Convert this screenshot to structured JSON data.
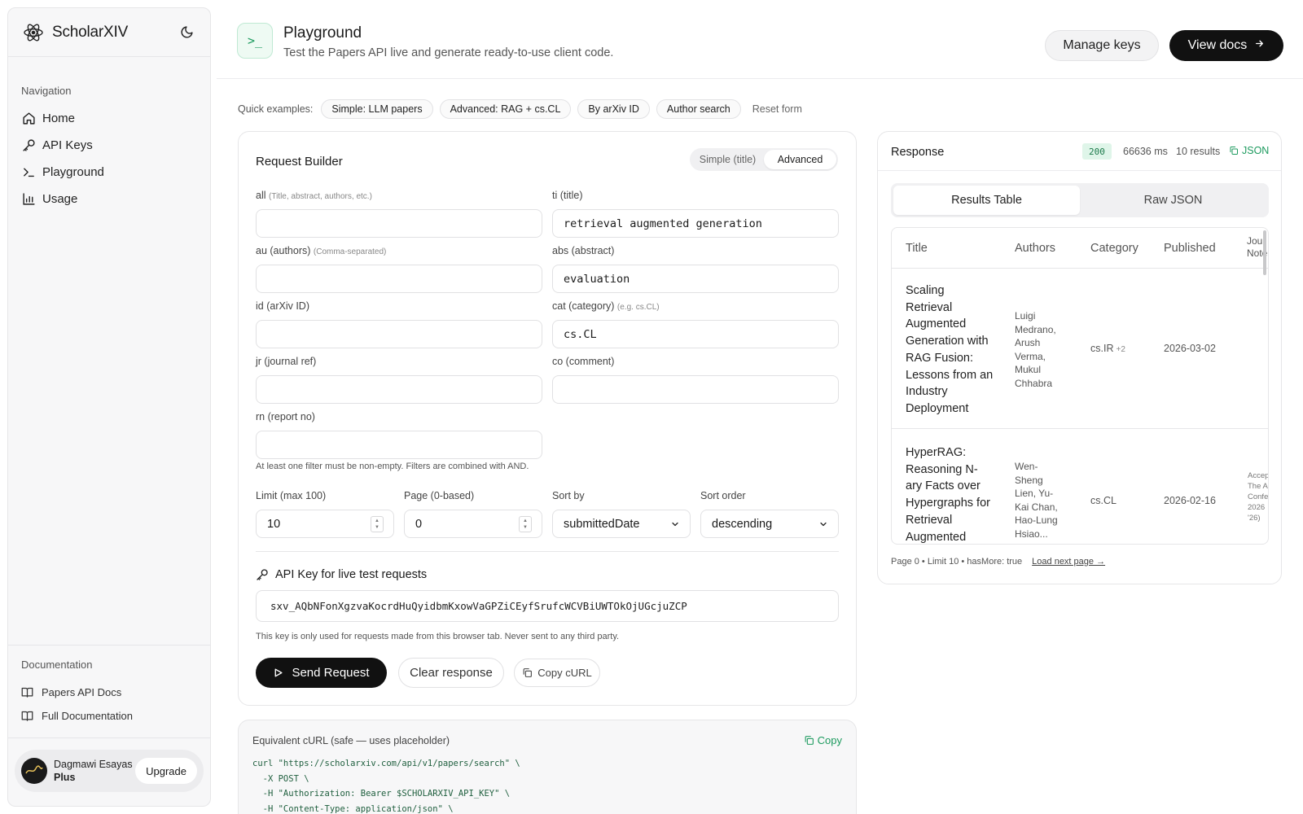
{
  "sidebar": {
    "brand": "ScholarXIV",
    "nav_title": "Navigation",
    "items": [
      {
        "label": "Home",
        "icon": "home-icon"
      },
      {
        "label": "API Keys",
        "icon": "key-icon"
      },
      {
        "label": "Playground",
        "icon": "terminal-icon"
      },
      {
        "label": "Usage",
        "icon": "bar-chart-icon"
      }
    ],
    "docs_title": "Documentation",
    "docs": [
      {
        "label": "Papers API Docs",
        "icon": "book-icon"
      },
      {
        "label": "Full Documentation",
        "icon": "book-icon"
      }
    ],
    "user": {
      "name": "Dagmawi Esayas",
      "plan": "Plus",
      "upgrade": "Upgrade"
    }
  },
  "header": {
    "title": "Playground",
    "subtitle": "Test the Papers API live and generate ready-to-use client code.",
    "manage_keys": "Manage keys",
    "view_docs": "View docs",
    "icon_glyph": ">_"
  },
  "quick": {
    "label": "Quick examples:",
    "chips": [
      "Simple: LLM papers",
      "Advanced: RAG + cs.CL",
      "By arXiv ID",
      "Author search"
    ],
    "reset": "Reset form"
  },
  "builder": {
    "title": "Request Builder",
    "mode_simple": "Simple (title)",
    "mode_advanced": "Advanced",
    "fields": {
      "all": {
        "label": "all",
        "hint": "(Title, abstract, authors, etc.)",
        "value": ""
      },
      "ti": {
        "label": "ti (title)",
        "hint": "",
        "value": "retrieval augmented generation"
      },
      "au": {
        "label": "au (authors)",
        "hint": "(Comma-separated)",
        "value": ""
      },
      "abs": {
        "label": "abs (abstract)",
        "hint": "",
        "value": "evaluation"
      },
      "id": {
        "label": "id (arXiv ID)",
        "hint": "",
        "value": ""
      },
      "cat": {
        "label": "cat (category)",
        "hint": "(e.g. cs.CL)",
        "value": "cs.CL"
      },
      "jr": {
        "label": "jr (journal ref)",
        "hint": "",
        "value": ""
      },
      "co": {
        "label": "co (comment)",
        "hint": "",
        "value": ""
      },
      "rn": {
        "label": "rn (report no)",
        "hint": "",
        "value": ""
      }
    },
    "note": "At least one filter must be non-empty. Filters are combined with AND.",
    "limit": {
      "label": "Limit (max 100)",
      "value": "10"
    },
    "page": {
      "label": "Page (0-based)",
      "value": "0"
    },
    "sort_by": {
      "label": "Sort by",
      "value": "submittedDate"
    },
    "sort_order": {
      "label": "Sort order",
      "value": "descending"
    },
    "api_key_title": "API Key for live test requests",
    "api_key_value": "sxv_AQbNFonXgzvaKocrdHuQyidbmKxowVaGPZiCEyfSrufcWCVBiUWTOkOjUGcjuZCP",
    "api_key_note": "This key is only used for requests made from this browser tab. Never sent to any third party.",
    "send": "Send Request",
    "clear": "Clear response",
    "copy_curl": "Copy cURL"
  },
  "curl": {
    "title": "Equivalent cURL (safe — uses placeholder)",
    "copy": "Copy",
    "lines": [
      "curl \"https://scholarxiv.com/api/v1/papers/search\" \\",
      "  -X POST \\",
      "  -H \"Authorization: Bearer $SCHOLARXIV_API_KEY\" \\",
      "  -H \"Content-Type: application/json\" \\"
    ]
  },
  "response": {
    "title": "Response",
    "status": "200",
    "time": "66636 ms",
    "count": "10 results",
    "json_link": "JSON",
    "tab_table": "Results Table",
    "tab_raw": "Raw JSON",
    "columns": [
      "Title",
      "Authors",
      "Category",
      "Published",
      "Jou Note"
    ],
    "rows": [
      {
        "title": "Scaling Retrieval Augmented Generation with RAG Fusion: Lessons from an Industry Deployment",
        "authors": "Luigi Medrano, Arush Verma, Mukul Chhabra",
        "category": "cs.IR",
        "category_extra": "+2",
        "published": "2026-03-02",
        "journal": ""
      },
      {
        "title": "HyperRAG: Reasoning N-ary Facts over Hypergraphs for Retrieval Augmented",
        "authors": "Wen-Sheng Lien, Yu-Kai Chan, Hao-Lung Hsiao...",
        "category": "cs.CL",
        "category_extra": "",
        "published": "2026-02-16",
        "journal": "Accep The A Confe 2026 '26)"
      }
    ],
    "footer": "Page 0 • Limit 10 • hasMore: true",
    "load_next": "Load next page →"
  },
  "colors": {
    "accent": "#1c9a5e",
    "dark": "#111111",
    "status_bg": "#dff5e9"
  }
}
